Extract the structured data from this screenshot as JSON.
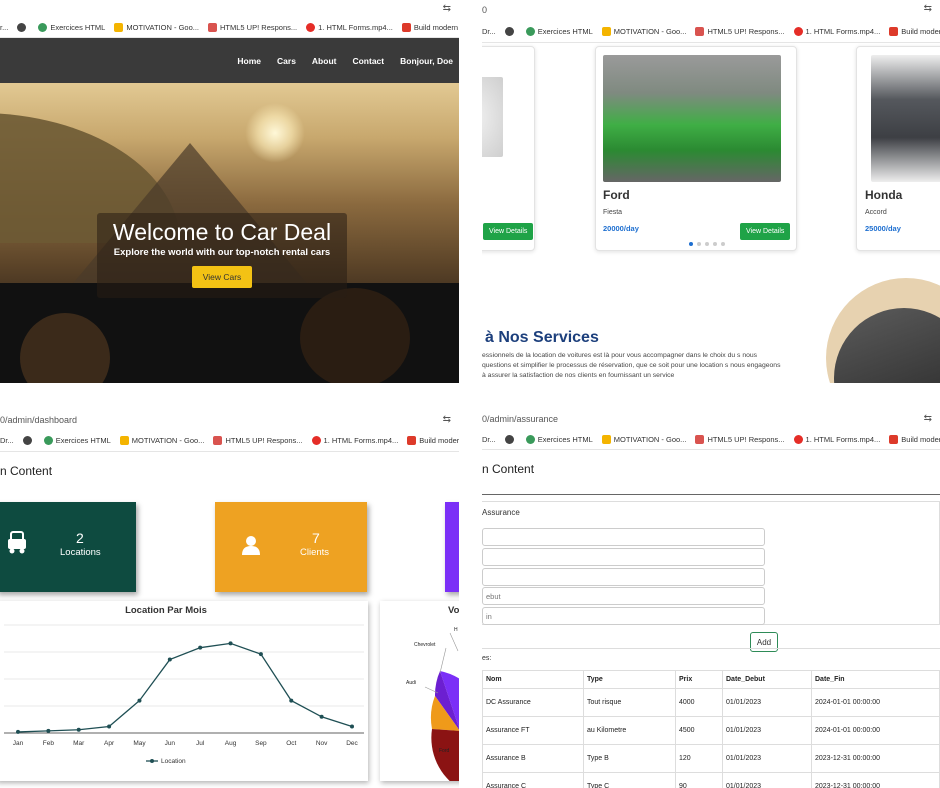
{
  "browser": {
    "q2_url": "0",
    "q3_url": "0/admin/dashboard",
    "q4_url": "0/admin/assurance",
    "bookmarks": [
      "Dr...",
      "Exercices HTML",
      "MOTIVATION - Goo...",
      "HTML5 UP! Respons...",
      "1. HTML Forms.mp4...",
      "Build modern respo..."
    ],
    "bookmarks_q1": [
      "r...",
      "Exercices HTML",
      "MOTIVATION - Goo...",
      "HTML5 UP! Respons...",
      "1. HTML Forms.mp4...",
      "Build modern respo..."
    ],
    "translate_icon": "translate-icon"
  },
  "site": {
    "nav": [
      "Home",
      "Cars",
      "About",
      "Contact",
      "Bonjour, Doe"
    ],
    "hero_title": "Welcome to Car Deal",
    "hero_subtitle": "Explore the world with our top-notch rental cars",
    "hero_button": "View Cars"
  },
  "cars": [
    {
      "make": "Ford",
      "model": "Fiesta",
      "price": "20000/day",
      "button": "View Details",
      "color": "#3fae45"
    },
    {
      "make": "Honda",
      "model": "Accord",
      "price": "25000/day",
      "button": "",
      "color": "#3d3f44"
    }
  ],
  "first_card_button": "View Details",
  "services": {
    "title": "à Nos Services",
    "text": "essionnels de la location de voitures est là pour vous accompagner dans le choix du s nous questions et simplifier le processus de réservation, que ce soit pour une location s nous engageons à assurer la satisfaction de nos clients en fournissant un service"
  },
  "dashboard": {
    "title": "n Content",
    "stats": [
      {
        "value": "2",
        "label": "Locations",
        "color": "#0e4b40"
      },
      {
        "value": "7",
        "label": "Clients",
        "color": "#eea222"
      }
    ],
    "third_stat_color": "#7b2ff7",
    "pie_title": "Vo",
    "pie_labels": [
      "H",
      "Chevrolet",
      "Audi",
      "Ford"
    ]
  },
  "chart_data": {
    "type": "line",
    "title": "Location Par Mois",
    "categories": [
      "Jan",
      "Feb",
      "Mar",
      "Apr",
      "May",
      "Jun",
      "Jul",
      "Aug",
      "Sep",
      "Oct",
      "Nov",
      "Dec"
    ],
    "series": [
      {
        "name": "Location",
        "values": [
          0.1,
          0.2,
          0.3,
          0.6,
          3.0,
          6.8,
          7.9,
          8.3,
          7.3,
          3.0,
          1.5,
          0.6
        ]
      }
    ],
    "ylim": [
      0,
      10
    ],
    "grid": true,
    "legend": "bottom",
    "color": "#1f4f54"
  },
  "assurance": {
    "title": "n Content",
    "form_label": "Assurance",
    "placeholders": [
      "",
      "",
      "",
      "ebut",
      "in"
    ],
    "add_button": "Add",
    "list_label": "es:",
    "columns": [
      "Nom",
      "Type",
      "Prix",
      "Date_Debut",
      "Date_Fin"
    ],
    "rows": [
      [
        "DC Assurance",
        "Tout risque",
        "4000",
        "01/01/2023",
        "2024-01-01 00:00:00"
      ],
      [
        "Assurance FT",
        "au Kilometre",
        "4500",
        "01/01/2023",
        "2024-01-01 00:00:00"
      ],
      [
        "Assurance B",
        "Type B",
        "120",
        "01/01/2023",
        "2023-12-31 00:00:00"
      ],
      [
        "Assurance C",
        "Type C",
        "90",
        "01/01/2023",
        "2023-12-31 00:00:00"
      ]
    ]
  }
}
